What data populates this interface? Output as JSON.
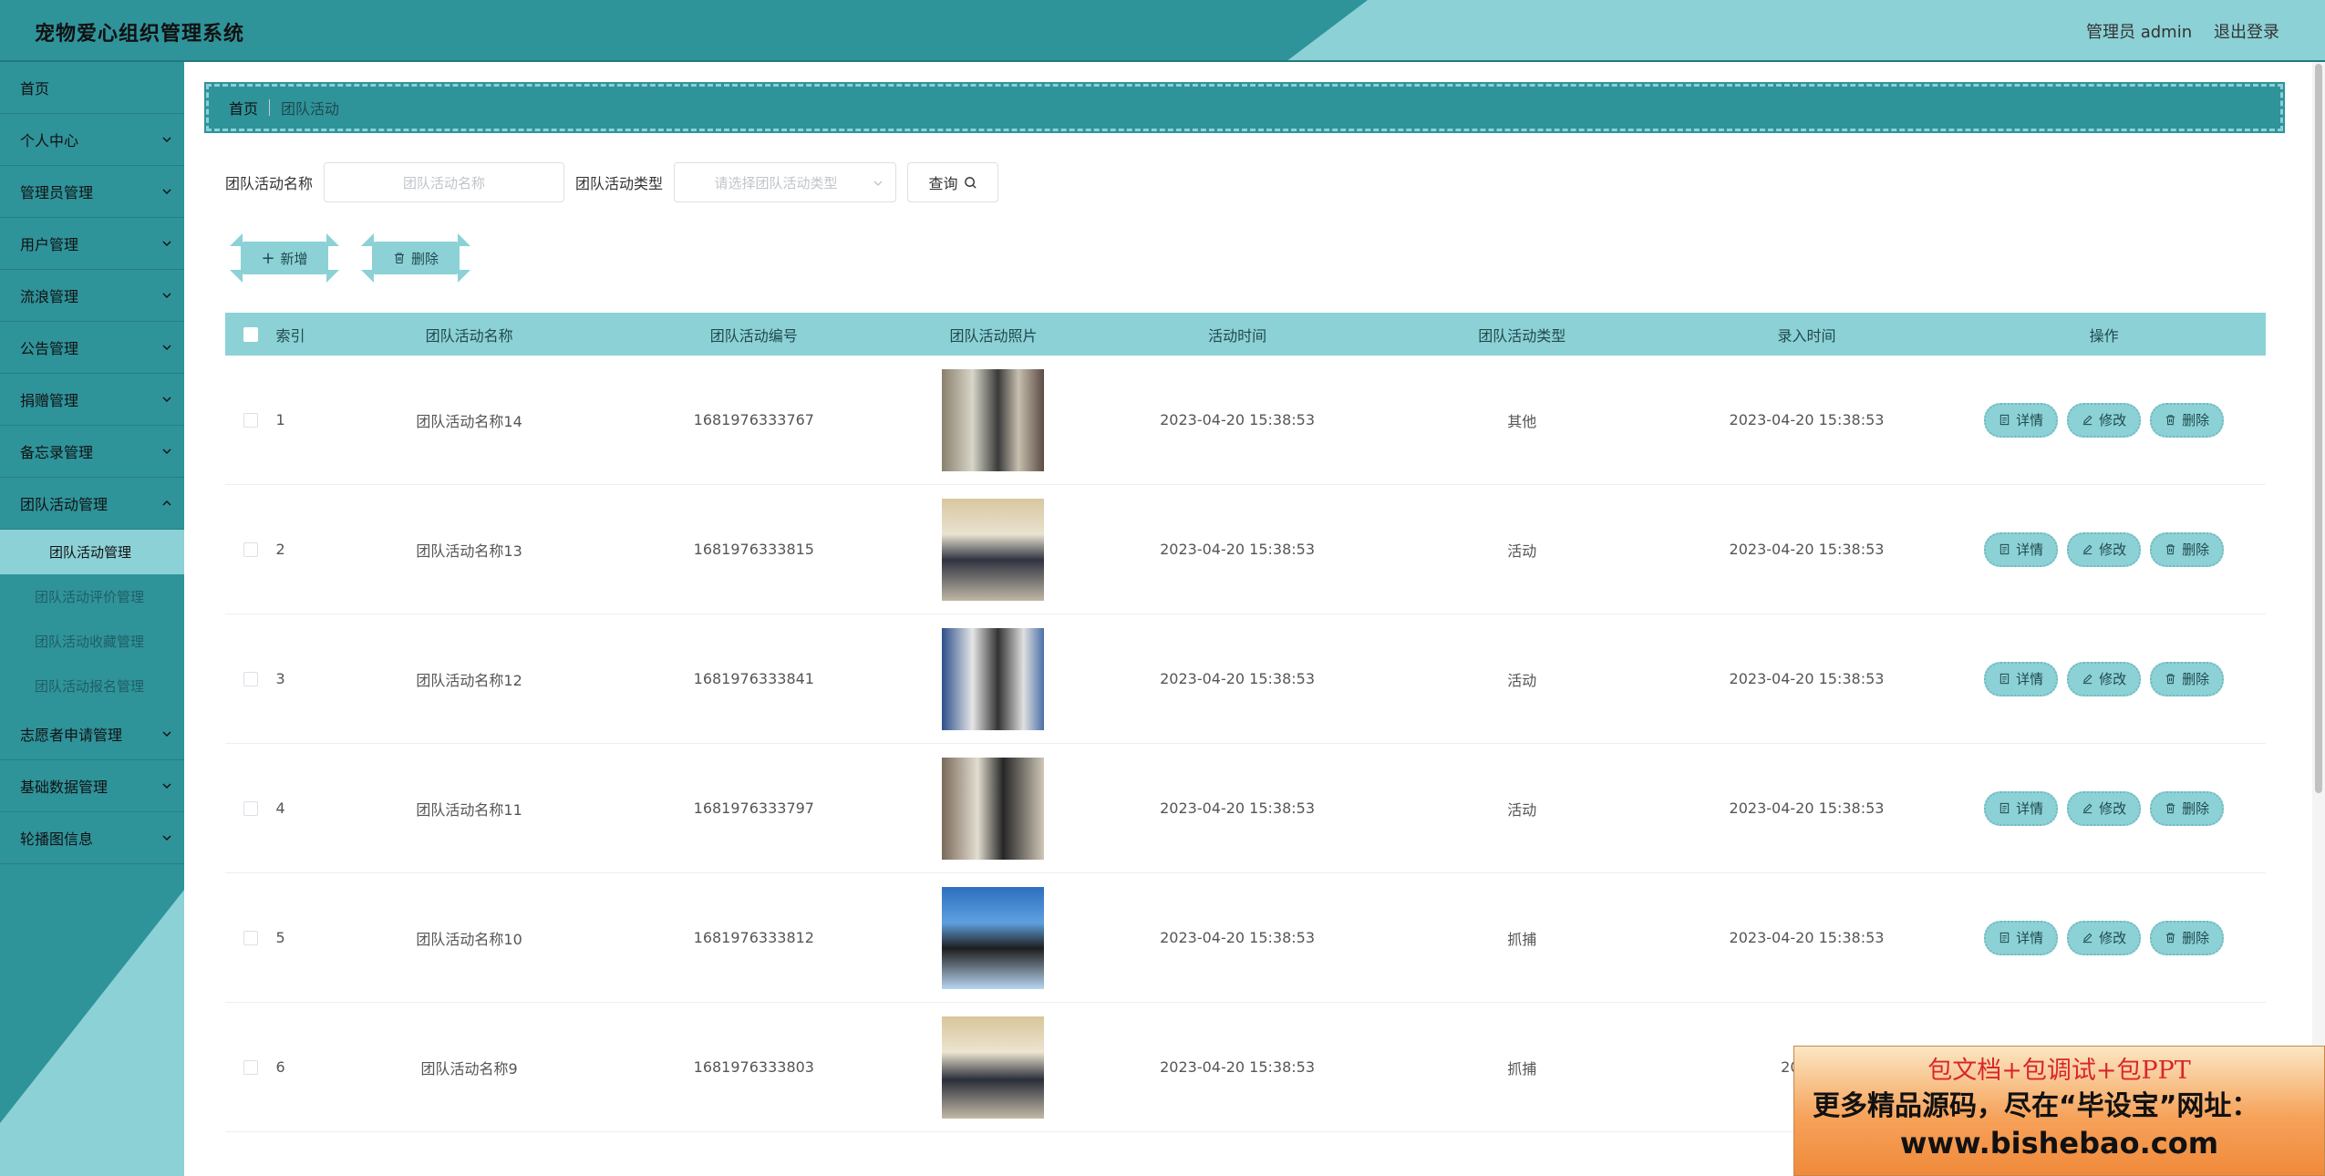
{
  "header": {
    "title": "宠物爱心组织管理系统",
    "user": "管理员 admin",
    "logout": "退出登录"
  },
  "sidebar": {
    "items": [
      {
        "label": "首页"
      },
      {
        "label": "个人中心"
      },
      {
        "label": "管理员管理"
      },
      {
        "label": "用户管理"
      },
      {
        "label": "流浪管理"
      },
      {
        "label": "公告管理"
      },
      {
        "label": "捐赠管理"
      },
      {
        "label": "备忘录管理"
      },
      {
        "label": "团队活动管理"
      }
    ],
    "subitems": [
      {
        "label": "团队活动管理"
      },
      {
        "label": "团队活动评价管理"
      },
      {
        "label": "团队活动收藏管理"
      },
      {
        "label": "团队活动报名管理"
      }
    ],
    "items_after": [
      {
        "label": "志愿者申请管理"
      },
      {
        "label": "基础数据管理"
      },
      {
        "label": "轮播图信息"
      }
    ]
  },
  "breadcrumb": {
    "home": "首页",
    "current": "团队活动"
  },
  "search": {
    "name_label": "团队活动名称",
    "name_placeholder": "团队活动名称",
    "type_label": "团队活动类型",
    "type_placeholder": "请选择团队活动类型",
    "query_button": "查询"
  },
  "actions": {
    "add": "新增",
    "delete": "删除"
  },
  "table": {
    "headers": {
      "index": "索引",
      "name": "团队活动名称",
      "code": "团队活动编号",
      "photo": "团队活动照片",
      "time": "活动时间",
      "type": "团队活动类型",
      "record_time": "录入时间",
      "ops": "操作"
    },
    "op_labels": {
      "detail": "详情",
      "edit": "修改",
      "delete": "删除"
    },
    "rows": [
      {
        "index": "1",
        "name": "团队活动名称14",
        "code": "1681976333767",
        "time": "2023-04-20 15:38:53",
        "type": "其他",
        "record_time": "2023-04-20 15:38:53"
      },
      {
        "index": "2",
        "name": "团队活动名称13",
        "code": "1681976333815",
        "time": "2023-04-20 15:38:53",
        "type": "活动",
        "record_time": "2023-04-20 15:38:53"
      },
      {
        "index": "3",
        "name": "团队活动名称12",
        "code": "1681976333841",
        "time": "2023-04-20 15:38:53",
        "type": "活动",
        "record_time": "2023-04-20 15:38:53"
      },
      {
        "index": "4",
        "name": "团队活动名称11",
        "code": "1681976333797",
        "time": "2023-04-20 15:38:53",
        "type": "活动",
        "record_time": "2023-04-20 15:38:53"
      },
      {
        "index": "5",
        "name": "团队活动名称10",
        "code": "1681976333812",
        "time": "2023-04-20 15:38:53",
        "type": "抓捕",
        "record_time": "2023-04-20 15:38:53"
      },
      {
        "index": "6",
        "name": "团队活动名称9",
        "code": "1681976333803",
        "time": "2023-04-20 15:38:53",
        "type": "抓捕",
        "record_time": "2023-0"
      }
    ]
  },
  "ad": {
    "line1": "包文档+包调试+包PPT",
    "line2": "更多精品源码，尽在“毕设宝”网址：",
    "line3": "www.bishebao.com"
  },
  "colors": {
    "primary": "#2f939a",
    "light": "#8cd1d6"
  }
}
